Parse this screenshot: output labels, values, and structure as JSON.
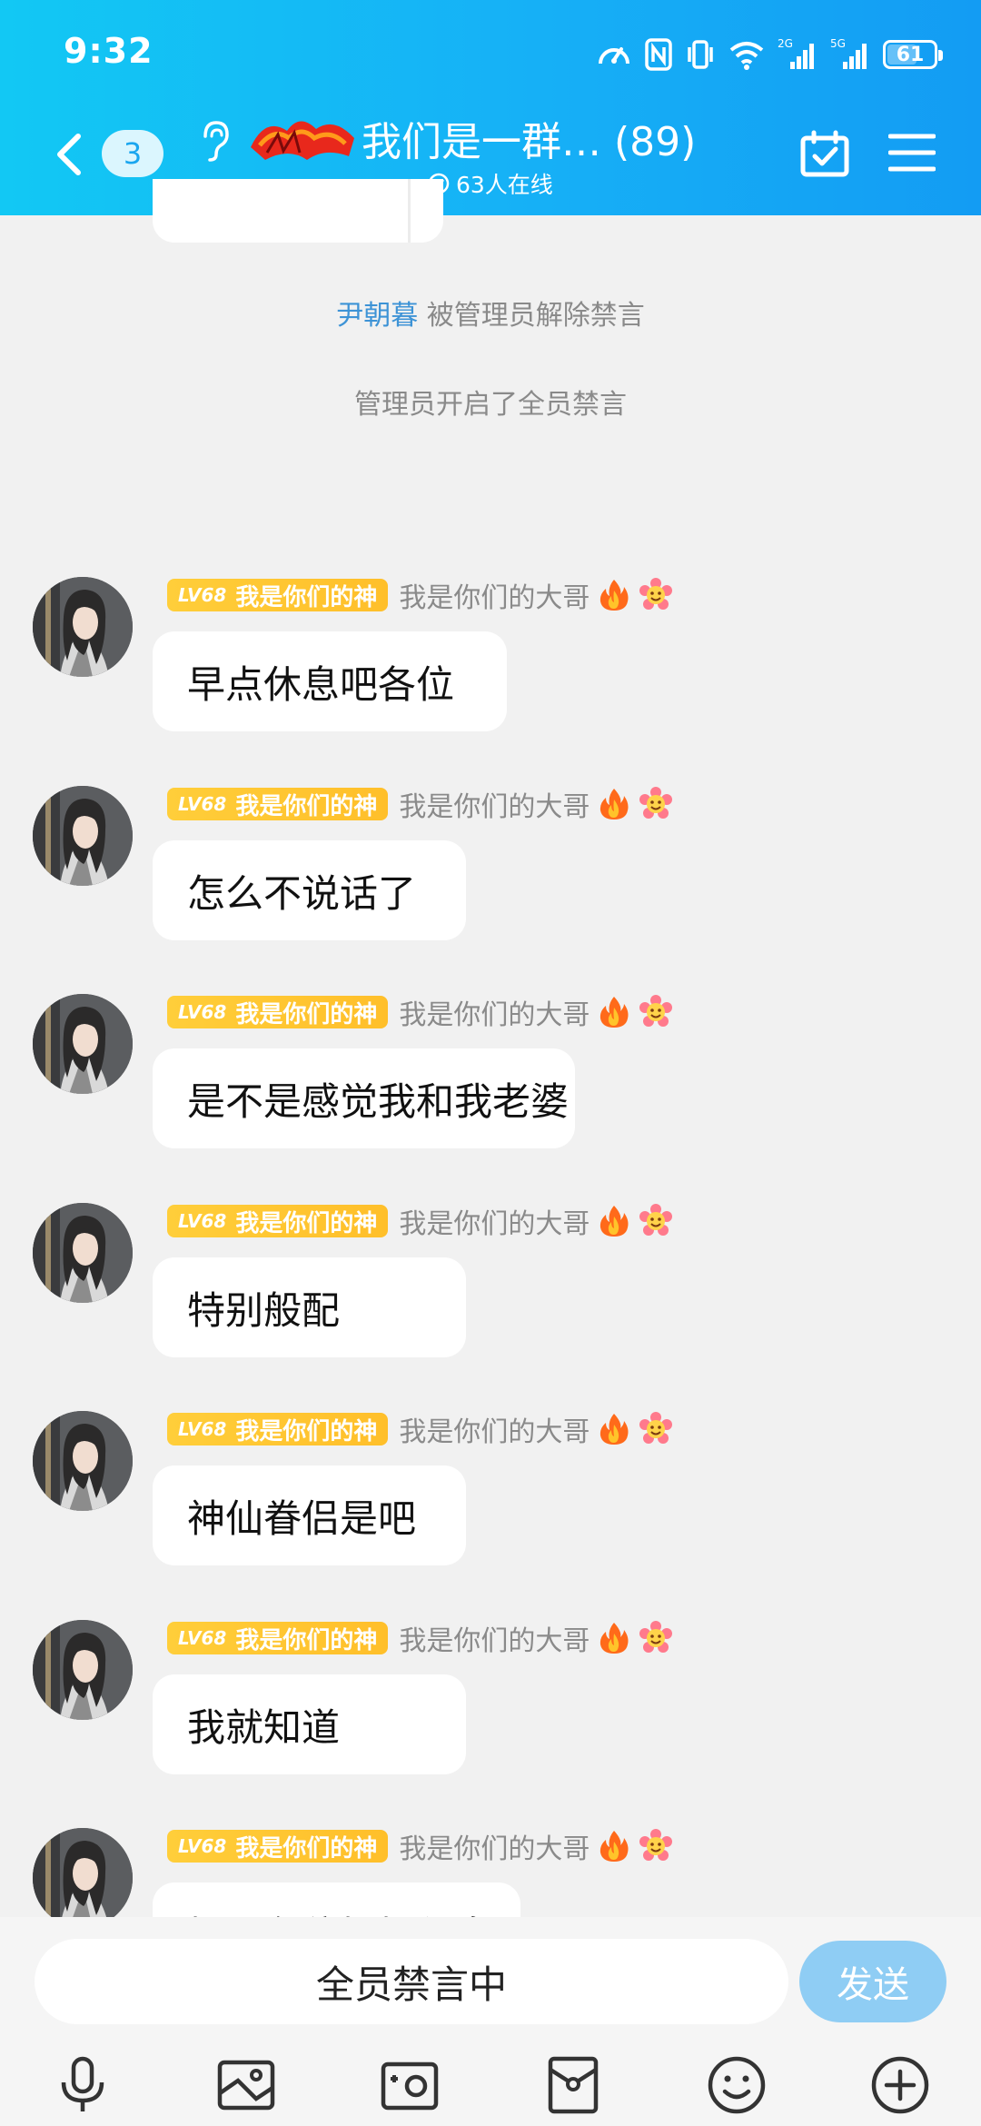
{
  "status": {
    "time": "9:32",
    "battery": "61",
    "signal1": "2G",
    "signal2": "5G"
  },
  "header": {
    "unread_count": "3",
    "group_name": "我们是一群… (89)",
    "online_text": "63人在线"
  },
  "system_messages": [
    {
      "user": "尹朝暮",
      "text": " 被管理员解除禁言"
    },
    {
      "user": "",
      "text": "管理员开启了全员禁言"
    }
  ],
  "sender": {
    "level": "LV68",
    "title": "我是你们的神",
    "nickname": "我是你们的大哥"
  },
  "messages": [
    {
      "text": "早点休息吧各位"
    },
    {
      "text": "怎么不说话了"
    },
    {
      "text": "是不是感觉我和我老婆"
    },
    {
      "text": "特别般配"
    },
    {
      "text": "神仙眷侣是吧"
    },
    {
      "text": "我就知道"
    },
    {
      "text": "好了各位好好休息"
    }
  ],
  "input": {
    "value": "全员禁言中",
    "send_label": "发送"
  },
  "colors": {
    "header_start": "#12c8f4",
    "header_end": "#139cf3",
    "send_button": "#8fcdf4",
    "level_tag": "#ffc832",
    "system_user": "#3d93d6"
  },
  "icons": [
    "back-icon",
    "ear-icon",
    "calendar-check-icon",
    "menu-icon",
    "mic-icon",
    "image-icon",
    "camera-icon",
    "red-packet-icon",
    "emoji-icon",
    "plus-icon"
  ]
}
